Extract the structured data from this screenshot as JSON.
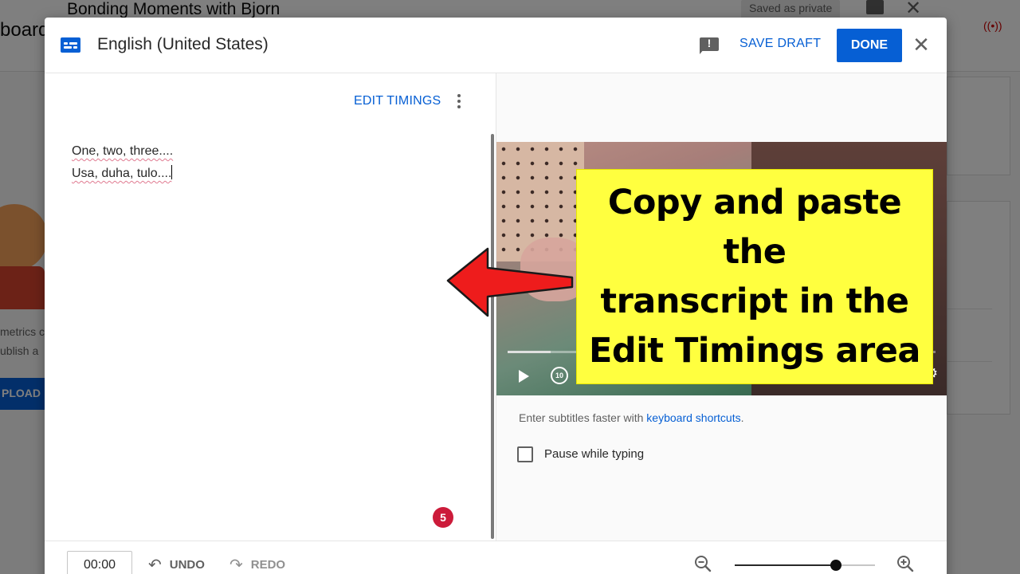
{
  "background": {
    "video_title": "Bonding Moments with Bjorn",
    "saved_status": "Saved as private",
    "dashboard_label": "board",
    "metrics_text_1": "metrics c",
    "metrics_text_2": "ublish a",
    "upload_label": "PLOAD"
  },
  "dialog": {
    "language_title": "English (United States)",
    "save_draft_label": "SAVE DRAFT",
    "done_label": "DONE",
    "close_glyph": "✕",
    "feedback_glyph": "!"
  },
  "editor": {
    "edit_timings_label": "EDIT TIMINGS",
    "transcript_lines": [
      "One, two, three....",
      "Usa, duha, tulo...."
    ],
    "badge_count": "5"
  },
  "player": {
    "progress_fraction": 0.1,
    "replay_label": "10",
    "hint_prefix": "Enter subtitles faster with ",
    "hint_link": "keyboard shortcuts",
    "hint_suffix": ".",
    "pause_label": "Pause while typing",
    "pause_checked": false
  },
  "callout": {
    "text_line1": "Copy and paste the",
    "text_line2": "transcript in the",
    "text_line3": "Edit Timings area",
    "bg_color": "#ffff3f",
    "arrow_color": "#ee1c1c"
  },
  "toolbar": {
    "timecode": "00:00",
    "undo_label": "UNDO",
    "redo_label": "REDO",
    "undo_glyph": "↶",
    "redo_glyph": "↷",
    "zoom_fraction": 0.72
  },
  "colors": {
    "accent": "#065fd4",
    "badge": "#cc1b3a"
  }
}
